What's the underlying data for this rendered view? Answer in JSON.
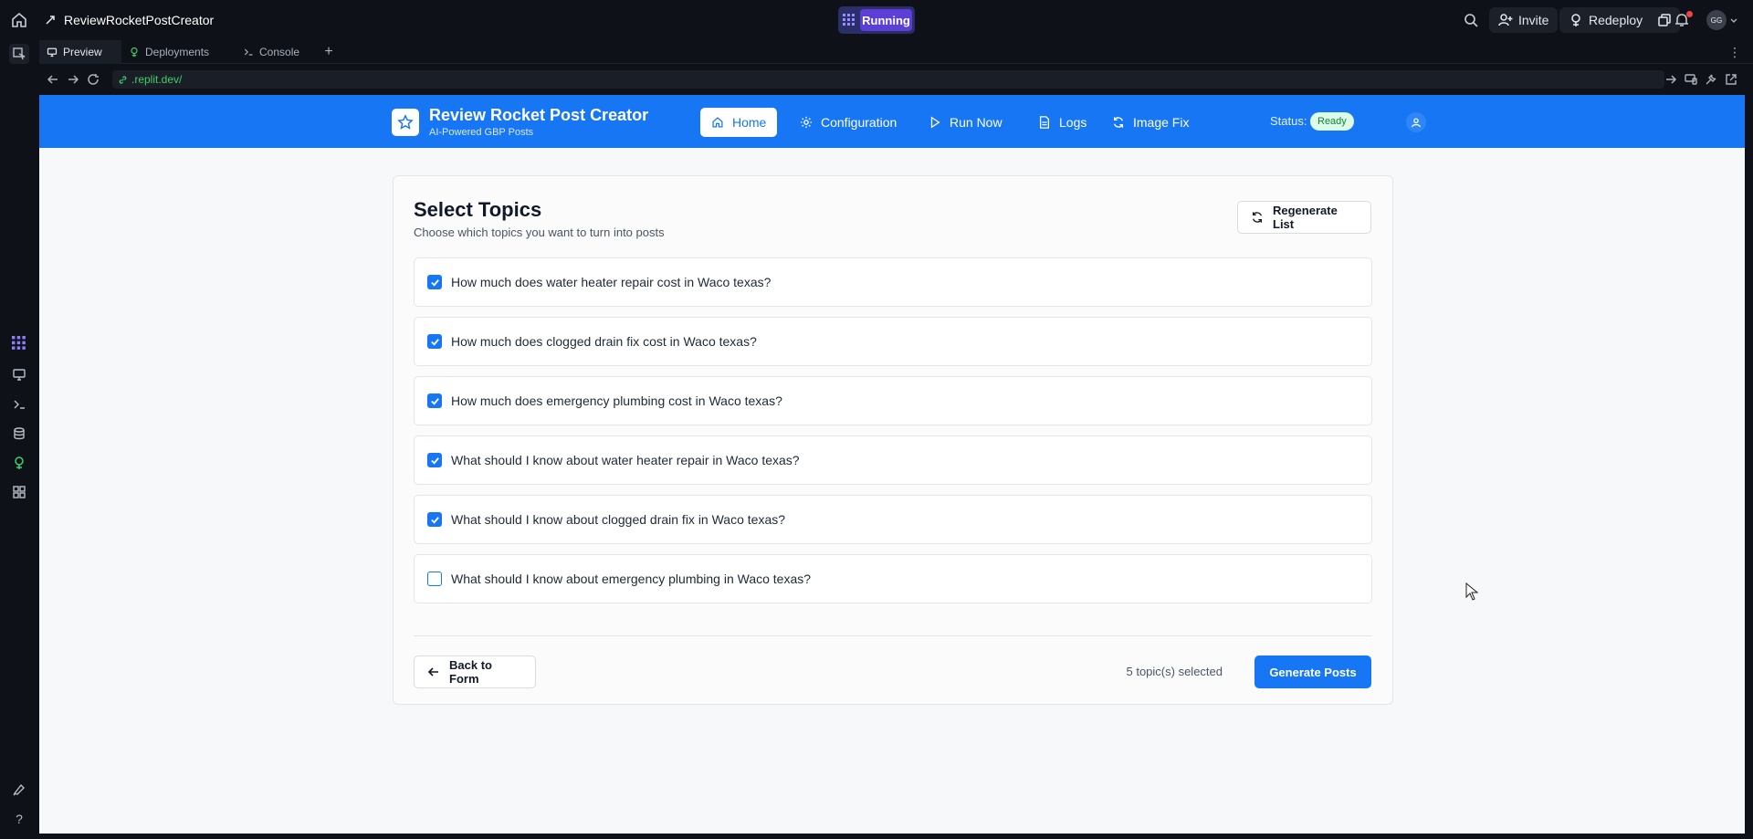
{
  "topbar": {
    "project_name": "ReviewRocketPostCreator",
    "run_status": "Running",
    "invite_label": "Invite",
    "redeploy_label": "Redeploy",
    "avatar_initials": "GG"
  },
  "tabs": [
    {
      "label": "Preview"
    },
    {
      "label": "Deployments"
    },
    {
      "label": "Console"
    }
  ],
  "url": {
    "value": ".replit.dev/"
  },
  "app": {
    "title": "Review Rocket Post Creator",
    "subtitle": "AI-Powered GBP Posts",
    "nav": [
      {
        "label": "Home",
        "icon": "home-icon",
        "active": true
      },
      {
        "label": "Configuration",
        "icon": "gear-icon"
      },
      {
        "label": "Run Now",
        "icon": "play-icon"
      },
      {
        "label": "Logs",
        "icon": "document-icon"
      },
      {
        "label": "Image Fix",
        "icon": "refresh-icon"
      }
    ],
    "status_label": "Status:",
    "status_value": "Ready"
  },
  "card": {
    "title": "Select Topics",
    "subtitle": "Choose which topics you want to turn into posts",
    "regenerate_label": "Regenerate List",
    "topics": [
      {
        "text": "How much does water heater repair cost in Waco texas?",
        "checked": true
      },
      {
        "text": "How much does clogged drain fix cost in Waco texas?",
        "checked": true
      },
      {
        "text": "How much does emergency plumbing cost in Waco texas?",
        "checked": true
      },
      {
        "text": "What should I know about water heater repair in Waco texas?",
        "checked": true
      },
      {
        "text": "What should I know about clogged drain fix in Waco texas?",
        "checked": true
      },
      {
        "text": "What should I know about emergency plumbing in Waco texas?",
        "checked": false
      }
    ],
    "back_label": "Back to Form",
    "selected_count": "5 topic(s) selected",
    "generate_label": "Generate Posts"
  },
  "colors": {
    "brand_blue": "#1676f3",
    "running_purple": "#5b3fd6",
    "ready_green": "#dcfce7"
  }
}
